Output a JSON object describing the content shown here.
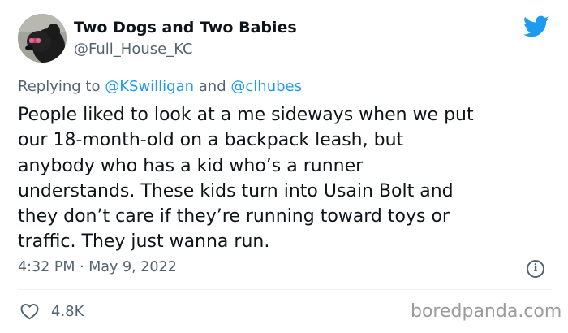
{
  "author": {
    "display_name": "Two Dogs and Two Babies",
    "handle": "@Full_House_KC",
    "avatar_icon": "dog-avatar"
  },
  "brand_icon": "twitter-bird-icon",
  "brand_color": "#1d9bf0",
  "reply": {
    "prefix": "Replying to",
    "user1": "@KSwilligan",
    "conjunction": "and",
    "user2": "@clhubes"
  },
  "body_lines": [
    "People liked to look at a me sideways when we put",
    "our 18-month-old on a backpack leash, but",
    "anybody who has a kid who’s a runner",
    "understands. These kids turn into Usain Bolt and",
    "they don’t care if they’re running toward toys or",
    "traffic. They just wanna run."
  ],
  "timestamp": "4:32 PM · May 9, 2022",
  "info_glyph": "i",
  "likes": {
    "icon": "heart-icon",
    "count": "4.8K"
  },
  "watermark": "boredpanda.com"
}
